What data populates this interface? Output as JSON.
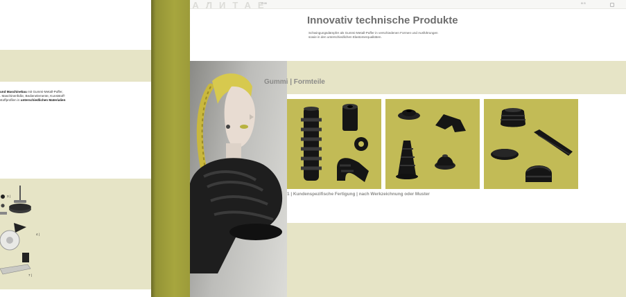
{
  "left_page": {
    "text_lines": [
      {
        "bold": "und Maschinebau",
        "rest": " mit Gummi-Metall-Puffer,"
      },
      {
        "bold": "",
        "rest": ". Maschinenfüße, Bedienelemente, Kunststoff-"
      },
      {
        "bold": "",
        "rest": "stoffprofilen in ",
        "bold2": "unterschiedlichen Materialien"
      }
    ],
    "callouts": [
      "3 |",
      "4 |",
      "7 |"
    ]
  },
  "browser": {
    "ghost_text": "ПАЛИТАЕ",
    "center_text": "10:08",
    "left_marker": "○",
    "right_marker": "⊞ ⊟"
  },
  "page": {
    "title": "Innovativ technische Produkte",
    "subtitle_lines": [
      "Schwingungsdämpfer als Gummi-Metall-Puffer in verschiedenen Formen und Ausführungen",
      "sowie in den unterschiedlichen Elastomerqualitäten."
    ],
    "section_heading": "Gummi | Formteile",
    "caption": "1 | Kundenspezifische Fertigung | nach Werkzeichnung oder Muster"
  },
  "colors": {
    "accent_olive": "#a7a63e",
    "tile_yellow": "#c2bb56",
    "band_beige": "#e6e4c6",
    "heading_gray": "#8a8a88"
  },
  "icons": [
    "bellows-part-icon",
    "bushing-part-icon",
    "ring-part-icon",
    "elbow-part-icon",
    "cone-part-icon",
    "boot-part-icon",
    "mount-part-icon",
    "foot-part-icon",
    "lip-part-icon",
    "profile-part-icon",
    "disc-part-icon"
  ]
}
